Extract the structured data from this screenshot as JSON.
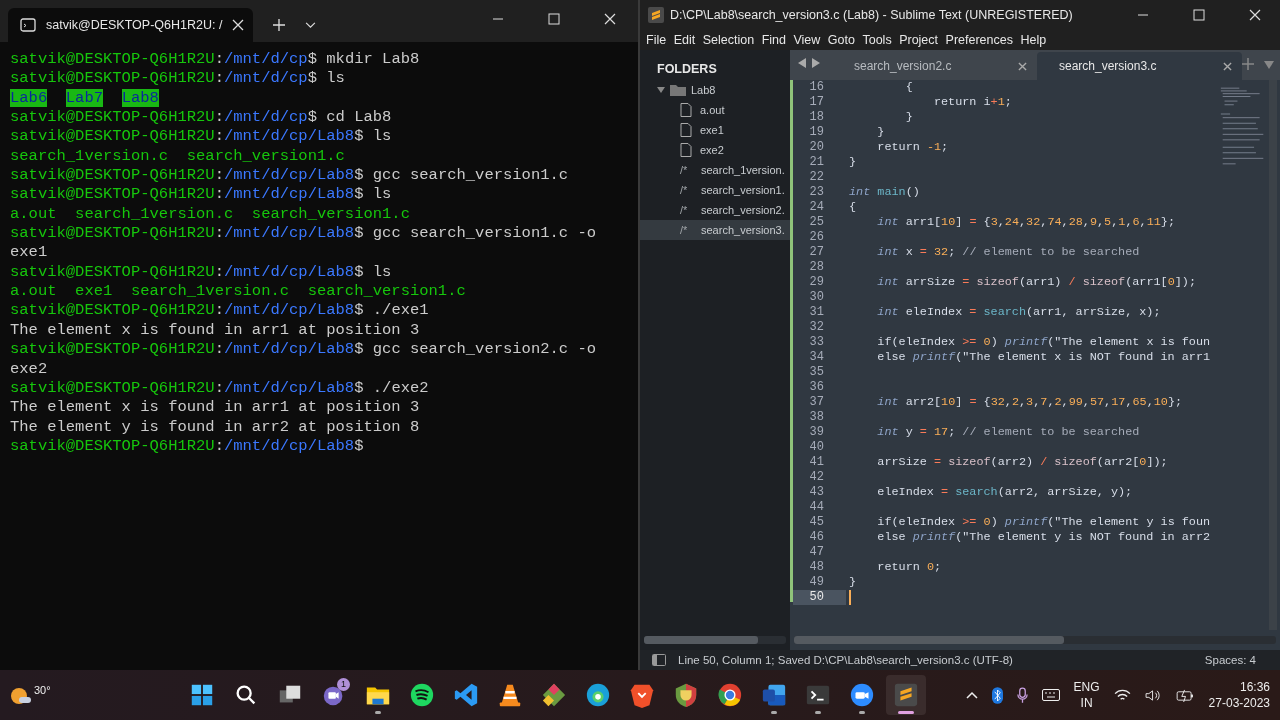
{
  "terminal": {
    "tab_title": "satvik@DESKTOP-Q6H1R2U: /",
    "lines": [
      [
        {
          "kind": "user",
          "text": "satvik@DESKTOP-Q6H1R2U"
        },
        {
          "kind": "text",
          "text": ":"
        },
        {
          "kind": "path",
          "text": "/mnt/d/cp"
        },
        {
          "kind": "text",
          "text": "$ mkdir Lab8"
        }
      ],
      [
        {
          "kind": "user",
          "text": "satvik@DESKTOP-Q6H1R2U"
        },
        {
          "kind": "text",
          "text": ":"
        },
        {
          "kind": "path",
          "text": "/mnt/d/cp"
        },
        {
          "kind": "text",
          "text": "$ ls"
        }
      ],
      [
        {
          "kind": "dir",
          "text": "Lab6"
        },
        {
          "kind": "dir",
          "text": "Lab7"
        },
        {
          "kind": "dir",
          "text": "Lab8"
        }
      ],
      [
        {
          "kind": "user",
          "text": "satvik@DESKTOP-Q6H1R2U"
        },
        {
          "kind": "text",
          "text": ":"
        },
        {
          "kind": "path",
          "text": "/mnt/d/cp"
        },
        {
          "kind": "text",
          "text": "$ cd Lab8"
        }
      ],
      [
        {
          "kind": "user",
          "text": "satvik@DESKTOP-Q6H1R2U"
        },
        {
          "kind": "text",
          "text": ":"
        },
        {
          "kind": "path",
          "text": "/mnt/d/cp/Lab8"
        },
        {
          "kind": "text",
          "text": "$ ls"
        }
      ],
      [
        {
          "kind": "file",
          "text": "search_1version.c  search_version1.c"
        }
      ],
      [
        {
          "kind": "user",
          "text": "satvik@DESKTOP-Q6H1R2U"
        },
        {
          "kind": "text",
          "text": ":"
        },
        {
          "kind": "path",
          "text": "/mnt/d/cp/Lab8"
        },
        {
          "kind": "text",
          "text": "$ gcc search_version1.c"
        }
      ],
      [
        {
          "kind": "user",
          "text": "satvik@DESKTOP-Q6H1R2U"
        },
        {
          "kind": "text",
          "text": ":"
        },
        {
          "kind": "path",
          "text": "/mnt/d/cp/Lab8"
        },
        {
          "kind": "text",
          "text": "$ ls"
        }
      ],
      [
        {
          "kind": "file",
          "text": "a.out  search_1version.c  search_version1.c"
        }
      ],
      [
        {
          "kind": "user",
          "text": "satvik@DESKTOP-Q6H1R2U"
        },
        {
          "kind": "text",
          "text": ":"
        },
        {
          "kind": "path",
          "text": "/mnt/d/cp/Lab8"
        },
        {
          "kind": "text",
          "text": "$ gcc search_version1.c -o"
        }
      ],
      [
        {
          "kind": "text",
          "text": "exe1"
        }
      ],
      [
        {
          "kind": "user",
          "text": "satvik@DESKTOP-Q6H1R2U"
        },
        {
          "kind": "text",
          "text": ":"
        },
        {
          "kind": "path",
          "text": "/mnt/d/cp/Lab8"
        },
        {
          "kind": "text",
          "text": "$ ls"
        }
      ],
      [
        {
          "kind": "file",
          "text": "a.out  exe1  search_1version.c  search_version1.c"
        }
      ],
      [
        {
          "kind": "user",
          "text": "satvik@DESKTOP-Q6H1R2U"
        },
        {
          "kind": "text",
          "text": ":"
        },
        {
          "kind": "path",
          "text": "/mnt/d/cp/Lab8"
        },
        {
          "kind": "text",
          "text": "$ ./exe1"
        }
      ],
      [
        {
          "kind": "text",
          "text": "The element x is found in arr1 at position 3"
        }
      ],
      [
        {
          "kind": "user",
          "text": "satvik@DESKTOP-Q6H1R2U"
        },
        {
          "kind": "text",
          "text": ":"
        },
        {
          "kind": "path",
          "text": "/mnt/d/cp/Lab8"
        },
        {
          "kind": "text",
          "text": "$ gcc search_version2.c -o"
        }
      ],
      [
        {
          "kind": "text",
          "text": "exe2"
        }
      ],
      [
        {
          "kind": "user",
          "text": "satvik@DESKTOP-Q6H1R2U"
        },
        {
          "kind": "text",
          "text": ":"
        },
        {
          "kind": "path",
          "text": "/mnt/d/cp/Lab8"
        },
        {
          "kind": "text",
          "text": "$ ./exe2"
        }
      ],
      [
        {
          "kind": "text",
          "text": "The element x is found in arr1 at position 3"
        }
      ],
      [
        {
          "kind": "text",
          "text": "The element y is found in arr2 at position 8"
        }
      ],
      [
        {
          "kind": "user",
          "text": "satvik@DESKTOP-Q6H1R2U"
        },
        {
          "kind": "text",
          "text": ":"
        },
        {
          "kind": "path",
          "text": "/mnt/d/cp/Lab8"
        },
        {
          "kind": "text",
          "text": "$"
        }
      ]
    ]
  },
  "editor": {
    "title": "D:\\CP\\Lab8\\search_version3.c (Lab8) - Sublime Text (UNREGISTERED)",
    "menu": [
      "File",
      "Edit",
      "Selection",
      "Find",
      "View",
      "Goto",
      "Tools",
      "Project",
      "Preferences",
      "Help"
    ],
    "sidebar": {
      "header": "FOLDERS",
      "folder": {
        "name": "Lab8",
        "expanded": true,
        "children": [
          {
            "kind": "file",
            "name": "a.out",
            "selected": false
          },
          {
            "kind": "file",
            "name": "exe1",
            "selected": false
          },
          {
            "kind": "file",
            "name": "exe2",
            "selected": false
          },
          {
            "kind": "source",
            "icon_text": "/*",
            "name": "search_1version.",
            "selected": false
          },
          {
            "kind": "source",
            "icon_text": "/*",
            "name": "search_version1.",
            "selected": false
          },
          {
            "kind": "source",
            "icon_text": "/*",
            "name": "search_version2.",
            "selected": false
          },
          {
            "kind": "source",
            "icon_text": "/*",
            "name": "search_version3.",
            "selected": true
          }
        ]
      }
    },
    "tabs": [
      {
        "label": "search_version2.c",
        "selected": false
      },
      {
        "label": "search_version3.c",
        "selected": true
      }
    ],
    "lines": [
      {
        "number": "16",
        "tokens": [
          {
            "kind": "t",
            "text": "        {"
          }
        ]
      },
      {
        "number": "17",
        "tokens": [
          {
            "kind": "t",
            "text": "            return i"
          },
          {
            "kind": "o",
            "text": "+"
          },
          {
            "kind": "n",
            "text": "1"
          },
          {
            "kind": "t",
            "text": ";"
          }
        ]
      },
      {
        "number": "18",
        "tokens": [
          {
            "kind": "t",
            "text": "        }"
          }
        ]
      },
      {
        "number": "19",
        "tokens": [
          {
            "kind": "t",
            "text": "    }"
          }
        ]
      },
      {
        "number": "20",
        "tokens": [
          {
            "kind": "t",
            "text": "    return "
          },
          {
            "kind": "n",
            "text": "-1"
          },
          {
            "kind": "t",
            "text": ";"
          }
        ]
      },
      {
        "number": "21",
        "tokens": [
          {
            "kind": "t",
            "text": "}"
          }
        ]
      },
      {
        "number": "22"
      },
      {
        "number": "23",
        "tokens": [
          {
            "kind": "k",
            "text": "int "
          },
          {
            "kind": "f",
            "text": "main"
          },
          {
            "kind": "t",
            "text": "()"
          }
        ]
      },
      {
        "number": "24",
        "tokens": [
          {
            "kind": "t",
            "text": "{"
          }
        ]
      },
      {
        "number": "25",
        "tokens": [
          {
            "kind": "k",
            "text": "    int"
          },
          {
            "kind": "t",
            "text": " arr1["
          },
          {
            "kind": "n",
            "text": "10"
          },
          {
            "kind": "t",
            "text": "] "
          },
          {
            "kind": "o",
            "text": "="
          },
          {
            "kind": "t",
            "text": " {"
          },
          {
            "kind": "n",
            "text": "3"
          },
          {
            "kind": "t",
            "text": ","
          },
          {
            "kind": "n",
            "text": "24"
          },
          {
            "kind": "t",
            "text": ","
          },
          {
            "kind": "n",
            "text": "32"
          },
          {
            "kind": "t",
            "text": ","
          },
          {
            "kind": "n",
            "text": "74"
          },
          {
            "kind": "t",
            "text": ","
          },
          {
            "kind": "n",
            "text": "28"
          },
          {
            "kind": "t",
            "text": ","
          },
          {
            "kind": "n",
            "text": "9"
          },
          {
            "kind": "t",
            "text": ","
          },
          {
            "kind": "n",
            "text": "5"
          },
          {
            "kind": "t",
            "text": ","
          },
          {
            "kind": "n",
            "text": "1"
          },
          {
            "kind": "t",
            "text": ","
          },
          {
            "kind": "n",
            "text": "6"
          },
          {
            "kind": "t",
            "text": ","
          },
          {
            "kind": "n",
            "text": "11"
          },
          {
            "kind": "t",
            "text": "};"
          }
        ]
      },
      {
        "number": "26"
      },
      {
        "number": "27",
        "tokens": [
          {
            "kind": "k",
            "text": "    int"
          },
          {
            "kind": "t",
            "text": " x "
          },
          {
            "kind": "o",
            "text": "="
          },
          {
            "kind": "n",
            "text": " 32"
          },
          {
            "kind": "t",
            "text": ";"
          },
          {
            "kind": "c",
            "text": " // element to be searched"
          }
        ]
      },
      {
        "number": "28"
      },
      {
        "number": "29",
        "tokens": [
          {
            "kind": "k",
            "text": "    int"
          },
          {
            "kind": "t",
            "text": " arrSize "
          },
          {
            "kind": "o",
            "text": "="
          },
          {
            "kind": "s",
            "text": " sizeof"
          },
          {
            "kind": "t",
            "text": "(arr1) "
          },
          {
            "kind": "o",
            "text": "/"
          },
          {
            "kind": "s",
            "text": " sizeof"
          },
          {
            "kind": "t",
            "text": "(arr1["
          },
          {
            "kind": "n",
            "text": "0"
          },
          {
            "kind": "t",
            "text": "]);"
          }
        ]
      },
      {
        "number": "30"
      },
      {
        "number": "31",
        "tokens": [
          {
            "kind": "k",
            "text": "    int"
          },
          {
            "kind": "t",
            "text": " eleIndex "
          },
          {
            "kind": "o",
            "text": "="
          },
          {
            "kind": "f",
            "text": " search"
          },
          {
            "kind": "t",
            "text": "(arr1, arrSize, x);"
          }
        ]
      },
      {
        "number": "32"
      },
      {
        "number": "33",
        "tokens": [
          {
            "kind": "t",
            "text": "    if(eleIndex "
          },
          {
            "kind": "o",
            "text": ">="
          },
          {
            "kind": "n",
            "text": " 0"
          },
          {
            "kind": "t",
            "text": ") "
          },
          {
            "kind": "k",
            "text": "printf"
          },
          {
            "kind": "t",
            "text": "(\"The element x is foun"
          }
        ]
      },
      {
        "number": "34",
        "tokens": [
          {
            "kind": "t",
            "text": "    else "
          },
          {
            "kind": "k",
            "text": "printf"
          },
          {
            "kind": "t",
            "text": "(\"The element x is NOT found in arr1"
          }
        ]
      },
      {
        "number": "35"
      },
      {
        "number": "36"
      },
      {
        "number": "37",
        "tokens": [
          {
            "kind": "k",
            "text": "    int"
          },
          {
            "kind": "t",
            "text": " arr2["
          },
          {
            "kind": "n",
            "text": "10"
          },
          {
            "kind": "t",
            "text": "] "
          },
          {
            "kind": "o",
            "text": "="
          },
          {
            "kind": "t",
            "text": " {"
          },
          {
            "kind": "n",
            "text": "32"
          },
          {
            "kind": "t",
            "text": ","
          },
          {
            "kind": "n",
            "text": "2"
          },
          {
            "kind": "t",
            "text": ","
          },
          {
            "kind": "n",
            "text": "3"
          },
          {
            "kind": "t",
            "text": ","
          },
          {
            "kind": "n",
            "text": "7"
          },
          {
            "kind": "t",
            "text": ","
          },
          {
            "kind": "n",
            "text": "2"
          },
          {
            "kind": "t",
            "text": ","
          },
          {
            "kind": "n",
            "text": "99"
          },
          {
            "kind": "t",
            "text": ","
          },
          {
            "kind": "n",
            "text": "57"
          },
          {
            "kind": "t",
            "text": ","
          },
          {
            "kind": "n",
            "text": "17"
          },
          {
            "kind": "t",
            "text": ","
          },
          {
            "kind": "n",
            "text": "65"
          },
          {
            "kind": "t",
            "text": ","
          },
          {
            "kind": "n",
            "text": "10"
          },
          {
            "kind": "t",
            "text": "};"
          }
        ]
      },
      {
        "number": "38"
      },
      {
        "number": "39",
        "tokens": [
          {
            "kind": "k",
            "text": "    int"
          },
          {
            "kind": "t",
            "text": " y "
          },
          {
            "kind": "o",
            "text": "="
          },
          {
            "kind": "n",
            "text": " 17"
          },
          {
            "kind": "t",
            "text": ";"
          },
          {
            "kind": "c",
            "text": " // element to be searched"
          }
        ]
      },
      {
        "number": "40"
      },
      {
        "number": "41",
        "tokens": [
          {
            "kind": "t",
            "text": "    arrSize "
          },
          {
            "kind": "o",
            "text": "="
          },
          {
            "kind": "s",
            "text": " sizeof"
          },
          {
            "kind": "t",
            "text": "(arr2) "
          },
          {
            "kind": "o",
            "text": "/"
          },
          {
            "kind": "s",
            "text": " sizeof"
          },
          {
            "kind": "t",
            "text": "(arr2["
          },
          {
            "kind": "n",
            "text": "0"
          },
          {
            "kind": "t",
            "text": "]);"
          }
        ]
      },
      {
        "number": "42"
      },
      {
        "number": "43",
        "tokens": [
          {
            "kind": "t",
            "text": "    eleIndex "
          },
          {
            "kind": "o",
            "text": "="
          },
          {
            "kind": "f",
            "text": " search"
          },
          {
            "kind": "t",
            "text": "(arr2, arrSize, y);"
          }
        ]
      },
      {
        "number": "44"
      },
      {
        "number": "45",
        "tokens": [
          {
            "kind": "t",
            "text": "    if(eleIndex "
          },
          {
            "kind": "o",
            "text": ">="
          },
          {
            "kind": "n",
            "text": " 0"
          },
          {
            "kind": "t",
            "text": ") "
          },
          {
            "kind": "k",
            "text": "printf"
          },
          {
            "kind": "t",
            "text": "(\"The element y is foun"
          }
        ]
      },
      {
        "number": "46",
        "tokens": [
          {
            "kind": "t",
            "text": "    else "
          },
          {
            "kind": "k",
            "text": "printf"
          },
          {
            "kind": "t",
            "text": "(\"The element y is NOT found in arr2"
          }
        ]
      },
      {
        "number": "47"
      },
      {
        "number": "48",
        "tokens": [
          {
            "kind": "t",
            "text": "    return "
          },
          {
            "kind": "n",
            "text": "0"
          },
          {
            "kind": "t",
            "text": ";"
          }
        ]
      },
      {
        "number": "49",
        "tokens": [
          {
            "kind": "t",
            "text": "}"
          }
        ]
      },
      {
        "number": "50",
        "current": true
      }
    ],
    "status": {
      "text": "Line 50, Column 1; Saved D:\\CP\\Lab8\\search_version3.c (UTF-8)",
      "indent": "Spaces: 4"
    }
  },
  "taskbar": {
    "temperature": "30°",
    "apps": [
      {
        "kind": "start",
        "running": false,
        "active": false
      },
      {
        "kind": "search",
        "running": false,
        "active": false
      },
      {
        "kind": "taskview",
        "running": false,
        "active": false
      },
      {
        "kind": "chat",
        "badge": "1",
        "running": false,
        "active": false
      },
      {
        "kind": "explorer",
        "running": true,
        "active": false
      },
      {
        "kind": "music",
        "running": false,
        "active": false
      },
      {
        "kind": "code",
        "running": false,
        "active": false
      },
      {
        "kind": "cone",
        "running": false,
        "active": false
      },
      {
        "kind": "diamond",
        "running": false,
        "active": false
      },
      {
        "kind": "edge",
        "running": false,
        "active": false
      },
      {
        "kind": "lion",
        "running": false,
        "active": false
      },
      {
        "kind": "shield",
        "running": false,
        "active": false
      },
      {
        "kind": "chrome",
        "running": false,
        "active": false
      },
      {
        "kind": "word",
        "running": true,
        "active": false
      },
      {
        "kind": "terminal",
        "running": true,
        "active": false
      },
      {
        "kind": "video",
        "running": true,
        "active": false
      },
      {
        "kind": "sublime",
        "running": true,
        "active": true
      }
    ],
    "language": "ENG",
    "region": "IN",
    "time": "16:36",
    "date": "27-03-2023"
  }
}
